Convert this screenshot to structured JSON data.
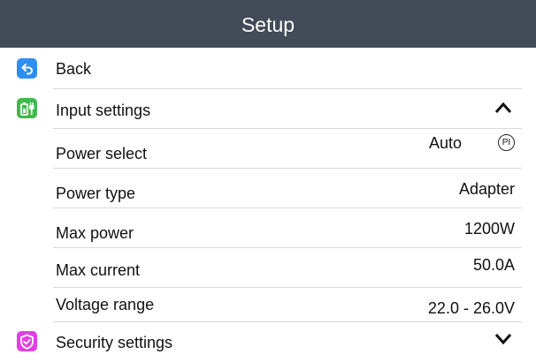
{
  "header": {
    "title": "Setup"
  },
  "menu": {
    "back": {
      "label": "Back",
      "icon": "back-arrow-icon",
      "color": "#2f8ff0"
    },
    "input_settings": {
      "label": "Input settings",
      "icon": "battery-plug-icon",
      "color": "#3fba4b",
      "expanded": true
    },
    "security_settings": {
      "label": "Security settings",
      "icon": "shield-icon",
      "color": "#e23ee6",
      "expanded": false
    }
  },
  "input_rows": {
    "power_select": {
      "label": "Power select",
      "value": "Auto",
      "badge": "PI"
    },
    "power_type": {
      "label": "Power type",
      "value": "Adapter"
    },
    "max_power": {
      "label": "Max power",
      "value": "1200W"
    },
    "max_current": {
      "label": "Max current",
      "value": "50.0A"
    },
    "voltage_range": {
      "label": "Voltage range",
      "value": "22.0 - 26.0V"
    }
  }
}
